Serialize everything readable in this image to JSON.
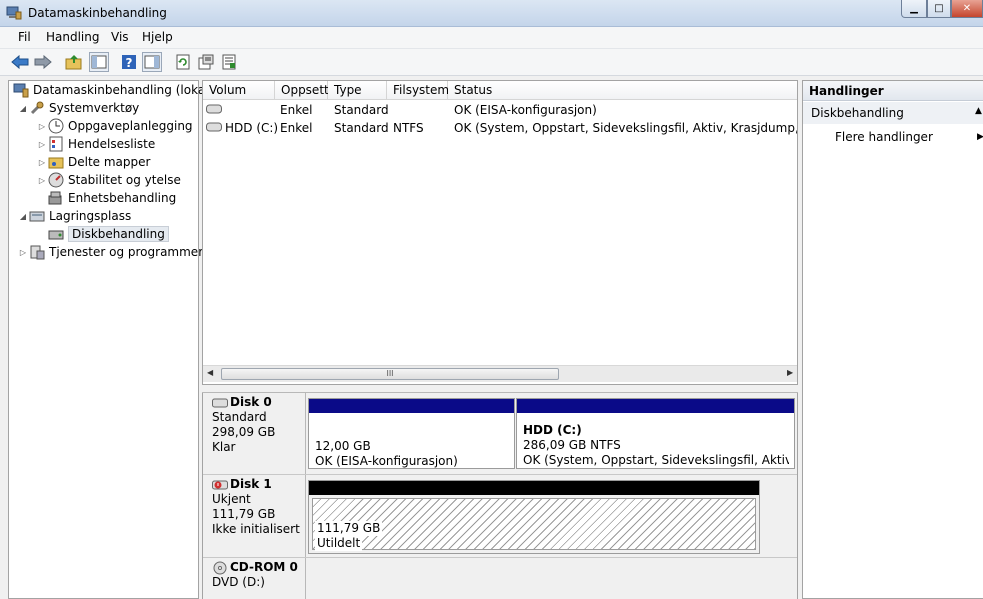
{
  "window": {
    "title": "Datamaskinbehandling"
  },
  "menu": [
    "Fil",
    "Handling",
    "Vis",
    "Hjelp"
  ],
  "toolbar": {
    "icons": [
      "back-arrow-icon",
      "forward-arrow-icon",
      "up-folder-icon",
      "show-hide-tree-icon",
      "help-icon",
      "show-hide-action-pane-icon",
      "refresh-icon",
      "properties-icon",
      "export-list-icon"
    ]
  },
  "tree": {
    "items": [
      {
        "label": "Datamaskinbehandling (lokal)",
        "icon": "computer-management-icon"
      },
      {
        "label": "Systemverktøy",
        "icon": "tools-icon"
      },
      {
        "label": "Oppgaveplanlegging",
        "icon": "clock-icon"
      },
      {
        "label": "Hendelsesliste",
        "icon": "event-viewer-icon"
      },
      {
        "label": "Delte mapper",
        "icon": "shared-folder-icon"
      },
      {
        "label": "Stabilitet og ytelse",
        "icon": "performance-icon"
      },
      {
        "label": "Enhetsbehandling",
        "icon": "device-manager-icon"
      },
      {
        "label": "Lagringsplass",
        "icon": "storage-icon"
      },
      {
        "label": "Diskbehandling",
        "icon": "disk-management-icon"
      },
      {
        "label": "Tjenester og programmer",
        "icon": "services-icon"
      }
    ]
  },
  "volumes": {
    "columns": [
      "Volum",
      "Oppsett",
      "Type",
      "Filsystem",
      "Status"
    ],
    "rows": [
      {
        "volum": "",
        "oppsett": "Enkel",
        "type": "Standard",
        "filsystem": "",
        "status": "OK (EISA-konfigurasjon)"
      },
      {
        "volum": "HDD (C:)",
        "oppsett": "Enkel",
        "type": "Standard",
        "filsystem": "NTFS",
        "status": "OK (System, Oppstart, Sidevekslingsfil, Aktiv, Krasjdump, Primær partisjon)"
      }
    ],
    "scroll_thumb_glyph": "III"
  },
  "disks": [
    {
      "name": "Disk 0",
      "type": "Standard",
      "size": "298,09 GB",
      "state": "Klar",
      "partitions": [
        {
          "title": "",
          "size": "12,00 GB",
          "status": "OK (EISA-konfigurasjon)"
        },
        {
          "title": "HDD  (C:)",
          "size": "286,09 GB NTFS",
          "status": "OK (System, Oppstart, Sidevekslingsfil, Aktiv, Krasjdump, Primær partisjon)"
        }
      ]
    },
    {
      "name": "Disk 1",
      "type": "Ukjent",
      "size": "111,79 GB",
      "state": "Ikke initialisert",
      "partitions": [
        {
          "size": "111,79 GB",
          "status": "Utildelt"
        }
      ]
    },
    {
      "name": "CD-ROM 0",
      "type": "DVD (D:)"
    }
  ],
  "actions": {
    "header": "Handlinger",
    "section": "Diskbehandling",
    "item": "Flere handlinger"
  },
  "colors": {
    "partition_bar": "#0a0a88",
    "unallocated_bar": "#000000",
    "selection": "#e5eaf0"
  }
}
